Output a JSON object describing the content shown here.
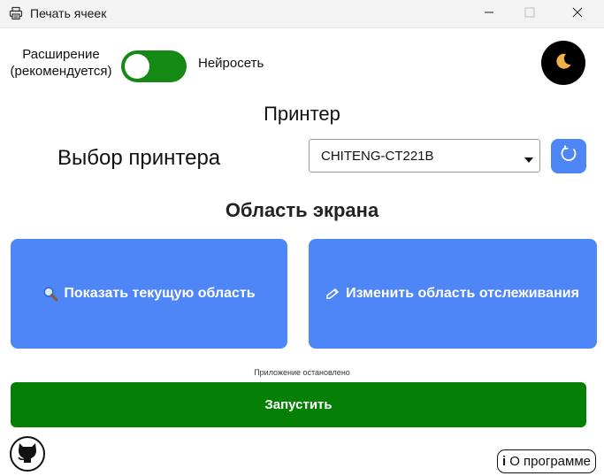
{
  "window": {
    "title": "Печать ячеек",
    "icons": {
      "app": "printer-icon",
      "minimize": "minimize-icon",
      "maximize": "maximize-icon",
      "close": "close-icon"
    }
  },
  "mode": {
    "left_label_line1": "Расширение",
    "left_label_line2": "(рекомендуется)",
    "right_label": "Нейросеть",
    "toggle_on": true,
    "toggle_color": "#148a14"
  },
  "theme": {
    "icon": "moon-icon"
  },
  "printer": {
    "section_title": "Принтер",
    "label": "Выбор принтера",
    "selected": "CHITENG-CT221B",
    "refresh_icon": "refresh-icon"
  },
  "screen_area": {
    "section_title": "Область экрана",
    "show_button": {
      "label": "Показать текущую область",
      "icon": "magnifier-icon"
    },
    "edit_button": {
      "label": "Изменить область отслеживания",
      "icon": "pencil-icon"
    },
    "button_color": "#4f86f7"
  },
  "status_text": "Приложение остановлено",
  "start_button": {
    "label": "Запустить",
    "color": "#058005"
  },
  "footer": {
    "github_icon": "github-icon",
    "about_icon": "info-icon",
    "about_symbol": "i",
    "about_label": "О программе"
  }
}
